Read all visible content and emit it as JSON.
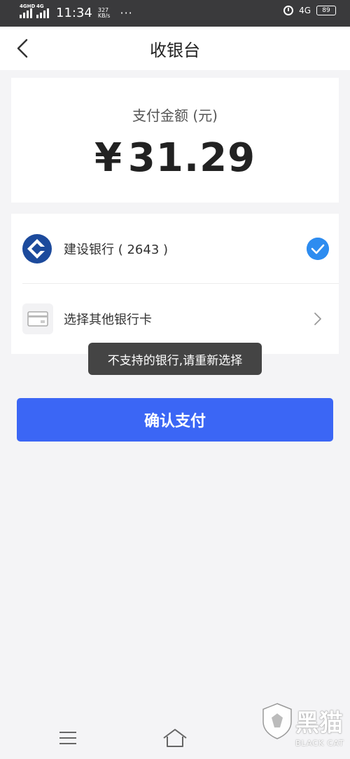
{
  "status_bar": {
    "network_1": "4GHD",
    "network_2": "4G",
    "time": "11:34",
    "speed_value": "327",
    "speed_unit": "KB/s",
    "more": "···",
    "network_right": "4G",
    "battery": "89"
  },
  "nav": {
    "title": "收银台"
  },
  "amount": {
    "label": "支付金额 (元)",
    "currency": "¥",
    "value": "31.29"
  },
  "methods": [
    {
      "label": "建设银行 ( 2643 )",
      "selected": true
    },
    {
      "label": "选择其他银行卡",
      "selected": false
    }
  ],
  "toast": {
    "message": "不支持的银行,请重新选择"
  },
  "confirm": {
    "label": "确认支付"
  },
  "watermark": {
    "text": "黑猫",
    "sub": "BLACK CAT"
  },
  "colors": {
    "primary": "#3b66f5",
    "check": "#2d8cf0",
    "bank_logo": "#1c4a9c"
  }
}
